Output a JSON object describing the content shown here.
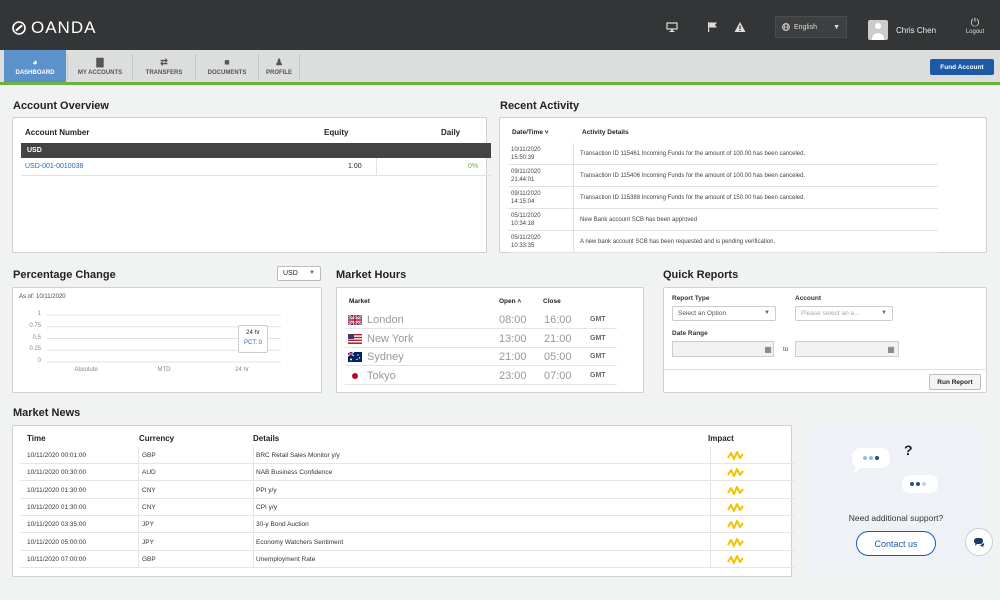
{
  "brand": {
    "name": "OANDA"
  },
  "header": {
    "language": "English",
    "user_name": "Chris Chen",
    "logout_label": "Logout"
  },
  "nav": {
    "items": [
      {
        "label": "DASHBOARD",
        "icon": "dashboard-icon"
      },
      {
        "label": "MY ACCOUNTS",
        "icon": "bar-chart-icon"
      },
      {
        "label": "TRANSFERS",
        "icon": "transfer-arrows-icon"
      },
      {
        "label": "DOCUMENTS",
        "icon": "folder-icon"
      },
      {
        "label": "PROFILE",
        "icon": "profile-icon"
      }
    ],
    "fund_account_label": "Fund Account"
  },
  "account_overview": {
    "title": "Account Overview",
    "columns": [
      "Account Number",
      "Equity",
      "Daily"
    ],
    "currency_group": "USD",
    "rows": [
      {
        "account": "USD-001-0010038",
        "equity": "1.00",
        "daily": "0%"
      }
    ]
  },
  "recent_activity": {
    "title": "Recent Activity",
    "columns": [
      "Date/Time ˅",
      "Activity Details"
    ],
    "rows": [
      {
        "date": "10/11/2020",
        "time": "15:50:39",
        "detail": "Transaction ID 115461 Incoming Funds for the amount of 100.00 has been canceled."
      },
      {
        "date": "09/11/2020",
        "time": "21:44:01",
        "detail": "Transaction ID 115406 Incoming Funds for the amount of 100.00 has been canceled."
      },
      {
        "date": "09/11/2020",
        "time": "14:15:04",
        "detail": "Transaction ID 115388 Incoming Funds for the amount of 150.00 has been canceled."
      },
      {
        "date": "05/11/2020",
        "time": "10:34:18",
        "detail": "New Bank account SCB has been approved"
      },
      {
        "date": "05/11/2020",
        "time": "10:33:35",
        "detail": "A new bank account SCB has been requested and is pending verification."
      }
    ]
  },
  "percentage_change": {
    "title": "Percentage Change",
    "currency": "USD",
    "as_of": "As of: 10/11/2020",
    "tooltip_label": "24 hr",
    "tooltip_value": "PCT: 0"
  },
  "chart_data": {
    "type": "bar",
    "categories": [
      "Absolute",
      "MTD",
      "24 hr"
    ],
    "values": [
      0,
      0,
      0
    ],
    "yticks": [
      "1",
      "0.75",
      "0.5",
      "0.25",
      "0"
    ],
    "ylim": [
      0,
      1
    ]
  },
  "market_hours": {
    "title": "Market Hours",
    "columns": [
      "Market",
      "Open ˄",
      "Close"
    ],
    "rows": [
      {
        "city": "London",
        "open": "08:00",
        "close": "16:00",
        "tz": "GMT",
        "flag": "uk-flag"
      },
      {
        "city": "New York",
        "open": "13:00",
        "close": "21:00",
        "tz": "GMT",
        "flag": "us-flag"
      },
      {
        "city": "Sydney",
        "open": "21:00",
        "close": "05:00",
        "tz": "GMT",
        "flag": "australia-flag"
      },
      {
        "city": "Tokyo",
        "open": "23:00",
        "close": "07:00",
        "tz": "GMT",
        "flag": "japan-flag"
      }
    ]
  },
  "quick_reports": {
    "title": "Quick Reports",
    "report_type_label": "Report Type",
    "report_type_placeholder": "Select an Option",
    "account_label": "Account",
    "account_placeholder": "Please select an a...",
    "date_range_label": "Date Range",
    "to_label": "to",
    "run_label": "Run Report"
  },
  "market_news": {
    "title": "Market News",
    "columns": [
      "Time",
      "Currency",
      "Details",
      "Impact"
    ],
    "rows": [
      {
        "time": "10/11/2020 00:01:00",
        "currency": "GBP",
        "details": "BRC Retail Sales Monitor y/y"
      },
      {
        "time": "10/11/2020 00:30:00",
        "currency": "AUD",
        "details": "NAB Business Confidence"
      },
      {
        "time": "10/11/2020 01:30:00",
        "currency": "CNY",
        "details": "PPI y/y"
      },
      {
        "time": "10/11/2020 01:30:00",
        "currency": "CNY",
        "details": "CPI y/y"
      },
      {
        "time": "10/11/2020 03:35:00",
        "currency": "JPY",
        "details": "30-y Bond Auction"
      },
      {
        "time": "10/11/2020 05:00:00",
        "currency": "JPY",
        "details": "Economy Watchers Sentiment"
      },
      {
        "time": "10/11/2020 07:00:00",
        "currency": "GBP",
        "details": "Unemployment Rate"
      }
    ],
    "impact_color": "#f2c200"
  },
  "support": {
    "question_mark": "?",
    "text": "Need additional support?",
    "contact_label": "Contact us"
  },
  "colors": {
    "accent": "#1c5aa6",
    "nav_active": "#5d91cb",
    "positive": "#6cb342",
    "topbar": "#333536"
  }
}
